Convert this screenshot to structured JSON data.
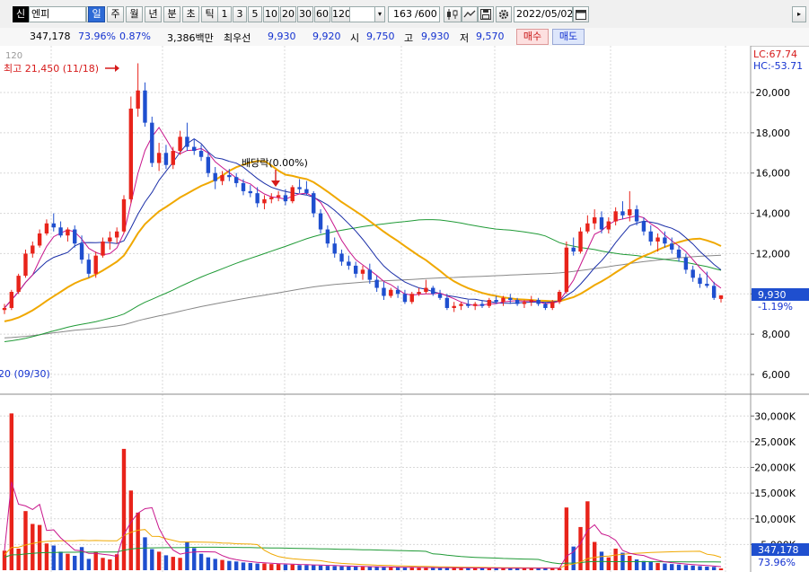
{
  "toolbar": {
    "market_badge": "신",
    "stock_name": "엔피",
    "period_buttons": [
      "일",
      "주",
      "월",
      "년",
      "분",
      "초",
      "틱"
    ],
    "active_period": "일",
    "interval_buttons": [
      "1",
      "3",
      "5",
      "10",
      "20",
      "30",
      "60",
      "120"
    ],
    "count": "163",
    "count_total": "/600",
    "date": "2022/05/02"
  },
  "quote": {
    "volume": "347,178",
    "vol_ratio": "73.96%",
    "turnover": "0.87%",
    "amount": "3,386백만",
    "best_bid_label": "최우선",
    "best_ask": "9,930",
    "best_bid": "9,920",
    "open_label": "시",
    "open": "9,750",
    "high_label": "고",
    "high": "9,930",
    "low_label": "저",
    "low": "9,570",
    "buy_label": "매수",
    "sell_label": "매도"
  },
  "chart": {
    "ma_label": "120",
    "high_annotation": "최고 21,450 (11/18)",
    "low_annotation": "20 (09/30)",
    "dividend_label": "배당락(0.00%)",
    "lc_label": "LC:67.74",
    "hc_label": "HC:-53.71",
    "price_ticks": [
      "20,000",
      "18,000",
      "16,000",
      "14,000",
      "12,000",
      "10,000",
      "8,000",
      "6,000"
    ],
    "current_price": "9,930",
    "current_change": "-1.19%",
    "volume_ticks": [
      "30,000K",
      "25,000K",
      "20,000K",
      "15,000K",
      "10,000K",
      "5,000K"
    ],
    "current_volume": "347,178",
    "current_vol_ratio": "73.96%"
  },
  "colors": {
    "up": "#e8231a",
    "down": "#1f4fcf",
    "ma5": "#c8168c",
    "ma10": "#1b2fa8",
    "ma20": "#f0a800",
    "ma60": "#1f9a36",
    "ma120": "#888888",
    "current_price_bg": "#1f4fcf"
  },
  "chart_data": {
    "type": "candlestick",
    "price_axis": {
      "min": 6000,
      "max": 20000,
      "ticks": [
        20000,
        18000,
        16000,
        14000,
        12000,
        10000,
        8000,
        6000
      ]
    },
    "candles_ohlc": [
      [
        9200,
        9500,
        9000,
        9300
      ],
      [
        9300,
        10200,
        9200,
        10100
      ],
      [
        10100,
        11000,
        10000,
        10900
      ],
      [
        10900,
        12200,
        10800,
        12000
      ],
      [
        12000,
        12600,
        11800,
        12400
      ],
      [
        12400,
        13200,
        12300,
        13000
      ],
      [
        13000,
        13700,
        12900,
        13500
      ],
      [
        13500,
        14000,
        13100,
        13300
      ],
      [
        13300,
        13600,
        12800,
        12900
      ],
      [
        12900,
        13300,
        12600,
        13200
      ],
      [
        13200,
        13400,
        12300,
        12500
      ],
      [
        12500,
        12900,
        11500,
        11700
      ],
      [
        11700,
        12000,
        10800,
        11000
      ],
      [
        11000,
        12100,
        10800,
        11900
      ],
      [
        11900,
        12800,
        11800,
        12600
      ],
      [
        12600,
        13100,
        12200,
        12800
      ],
      [
        12800,
        13300,
        12500,
        13100
      ],
      [
        13100,
        14900,
        13000,
        14700
      ],
      [
        14700,
        19800,
        14500,
        19200
      ],
      [
        19200,
        21450,
        18800,
        20100
      ],
      [
        20100,
        20500,
        18300,
        18500
      ],
      [
        18500,
        18800,
        16300,
        16500
      ],
      [
        16500,
        17500,
        16100,
        17000
      ],
      [
        17000,
        17400,
        16200,
        16400
      ],
      [
        16400,
        17300,
        16200,
        17100
      ],
      [
        17100,
        18100,
        16900,
        17800
      ],
      [
        17800,
        18500,
        17100,
        17300
      ],
      [
        17300,
        17700,
        16900,
        17100
      ],
      [
        17100,
        17400,
        16600,
        16800
      ],
      [
        16800,
        17000,
        15800,
        16000
      ],
      [
        16000,
        16300,
        15200,
        15600
      ],
      [
        15600,
        16100,
        15400,
        15900
      ],
      [
        15900,
        16200,
        15600,
        15800
      ],
      [
        15800,
        16000,
        15300,
        15500
      ],
      [
        15500,
        15700,
        14900,
        15100
      ],
      [
        15100,
        15400,
        14800,
        15000
      ],
      [
        15000,
        15300,
        14300,
        14500
      ],
      [
        14500,
        14900,
        14200,
        14700
      ],
      [
        14700,
        15000,
        14500,
        14800
      ],
      [
        14800,
        15100,
        14600,
        14900
      ],
      [
        14900,
        15200,
        14400,
        14600
      ],
      [
        14600,
        15400,
        14500,
        15300
      ],
      [
        15300,
        15700,
        15000,
        15200
      ],
      [
        15200,
        15600,
        14900,
        15000
      ],
      [
        15000,
        15100,
        13800,
        14000
      ],
      [
        14000,
        14200,
        13000,
        13200
      ],
      [
        13200,
        13400,
        12300,
        12500
      ],
      [
        12500,
        12800,
        11800,
        12000
      ],
      [
        12000,
        12200,
        11400,
        11600
      ],
      [
        11600,
        11900,
        11200,
        11400
      ],
      [
        11400,
        11600,
        10800,
        11000
      ],
      [
        11000,
        11400,
        10700,
        11200
      ],
      [
        11200,
        11500,
        10500,
        10700
      ],
      [
        10700,
        10900,
        10100,
        10300
      ],
      [
        10300,
        10600,
        9700,
        9900
      ],
      [
        9900,
        10300,
        9800,
        10200
      ],
      [
        10200,
        10400,
        9800,
        10000
      ],
      [
        10000,
        10200,
        9500,
        9600
      ],
      [
        9600,
        10100,
        9500,
        10000
      ],
      [
        10000,
        10300,
        9900,
        10100
      ],
      [
        10100,
        10700,
        10000,
        10300
      ],
      [
        10300,
        10400,
        9900,
        10000
      ],
      [
        10000,
        10200,
        9700,
        9800
      ],
      [
        9800,
        10000,
        9200,
        9300
      ],
      [
        9300,
        9600,
        9100,
        9400
      ],
      [
        9400,
        9600,
        9200,
        9500
      ],
      [
        9500,
        9700,
        9300,
        9400
      ],
      [
        9400,
        9600,
        9200,
        9500
      ],
      [
        9500,
        9700,
        9300,
        9400
      ],
      [
        9400,
        9800,
        9300,
        9700
      ],
      [
        9700,
        9900,
        9500,
        9600
      ],
      [
        9600,
        9900,
        9400,
        9800
      ],
      [
        9800,
        10000,
        9500,
        9700
      ],
      [
        9700,
        9800,
        9400,
        9500
      ],
      [
        9500,
        9700,
        9300,
        9600
      ],
      [
        9600,
        9900,
        9400,
        9700
      ],
      [
        9700,
        9800,
        9400,
        9500
      ],
      [
        9500,
        9600,
        9200,
        9300
      ],
      [
        9300,
        9700,
        9200,
        9600
      ],
      [
        9600,
        10200,
        9500,
        10100
      ],
      [
        10100,
        12600,
        10000,
        12300
      ],
      [
        12300,
        12800,
        11900,
        12100
      ],
      [
        12100,
        13300,
        12000,
        13100
      ],
      [
        13100,
        13900,
        13000,
        13500
      ],
      [
        13500,
        14200,
        13200,
        13800
      ],
      [
        13800,
        14100,
        13000,
        13200
      ],
      [
        13200,
        13800,
        13000,
        13600
      ],
      [
        13600,
        14300,
        13400,
        14100
      ],
      [
        14100,
        14600,
        13700,
        13900
      ],
      [
        13900,
        15100,
        13600,
        14200
      ],
      [
        14200,
        14400,
        13400,
        13600
      ],
      [
        13600,
        13800,
        12900,
        13100
      ],
      [
        13100,
        13400,
        12400,
        12600
      ],
      [
        12600,
        13000,
        12100,
        12800
      ],
      [
        12800,
        13100,
        12300,
        12500
      ],
      [
        12500,
        12800,
        12000,
        12200
      ],
      [
        12200,
        12400,
        11600,
        11800
      ],
      [
        11800,
        12000,
        11000,
        11200
      ],
      [
        11200,
        11400,
        10600,
        10800
      ],
      [
        10800,
        11000,
        10300,
        10500
      ],
      [
        10500,
        11100,
        10300,
        10400
      ],
      [
        10400,
        10600,
        9700,
        9800
      ],
      [
        9750,
        9930,
        9570,
        9930
      ]
    ],
    "volume_k": [
      3800,
      30500,
      4200,
      11500,
      9000,
      8800,
      5200,
      4800,
      3600,
      3200,
      2800,
      4500,
      2200,
      3600,
      2400,
      2100,
      3100,
      23600,
      15500,
      11200,
      6400,
      4100,
      3600,
      2900,
      2600,
      2400,
      5500,
      4300,
      3200,
      2500,
      2200,
      2000,
      1800,
      1700,
      1500,
      1400,
      1300,
      1300,
      1200,
      1200,
      1100,
      1100,
      1000,
      1000,
      950,
      900,
      850,
      800,
      760,
      720,
      700,
      680,
      650,
      620,
      600,
      580,
      560,
      540,
      520,
      500,
      490,
      480,
      470,
      460,
      450,
      440,
      430,
      420,
      410,
      400,
      400,
      400,
      390,
      390,
      380,
      380,
      380,
      370,
      370,
      370,
      12200,
      4600,
      8400,
      13400,
      5500,
      3600,
      2500,
      4200,
      3400,
      2800,
      2100,
      1800,
      1600,
      1400,
      1300,
      1200,
      1100,
      1000,
      900,
      800,
      700,
      650,
      347
    ]
  }
}
